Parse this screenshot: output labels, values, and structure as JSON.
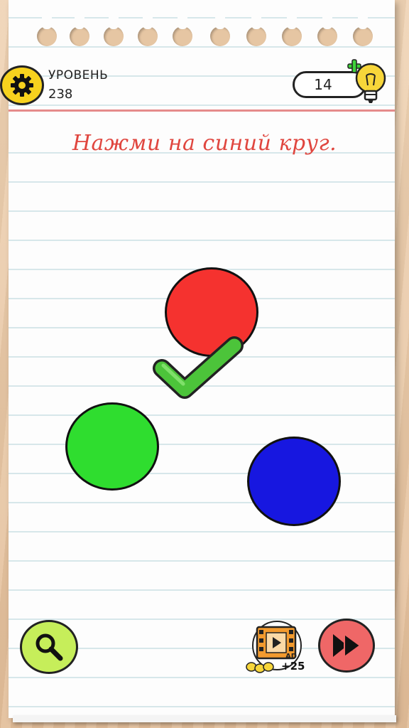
{
  "header": {
    "level_label": "УРОВЕНЬ",
    "level_number": "238",
    "hints_count": "14"
  },
  "icons": {
    "settings": "gear-icon",
    "hint": "lightbulb-plus-icon",
    "search": "magnifier-icon",
    "video_ad": "film-ad-icon",
    "skip": "fast-forward-icon"
  },
  "puzzle": {
    "question": "Нажми на синий круг.",
    "circles": [
      {
        "color_name": "red",
        "color": "#f5322f"
      },
      {
        "color_name": "green",
        "color": "#2fdd2f"
      },
      {
        "color_name": "blue",
        "color": "#1717e0"
      }
    ],
    "checkmark_color": "#4cc43a"
  },
  "footer": {
    "video_ad_label": "AD",
    "video_bonus": "+25"
  },
  "colors": {
    "settings_button": "#f7d21e",
    "search_button": "#c6ee5a",
    "skip_button": "#ef6767",
    "question_text": "#e0463f",
    "header_rule": "#e58b8b"
  }
}
